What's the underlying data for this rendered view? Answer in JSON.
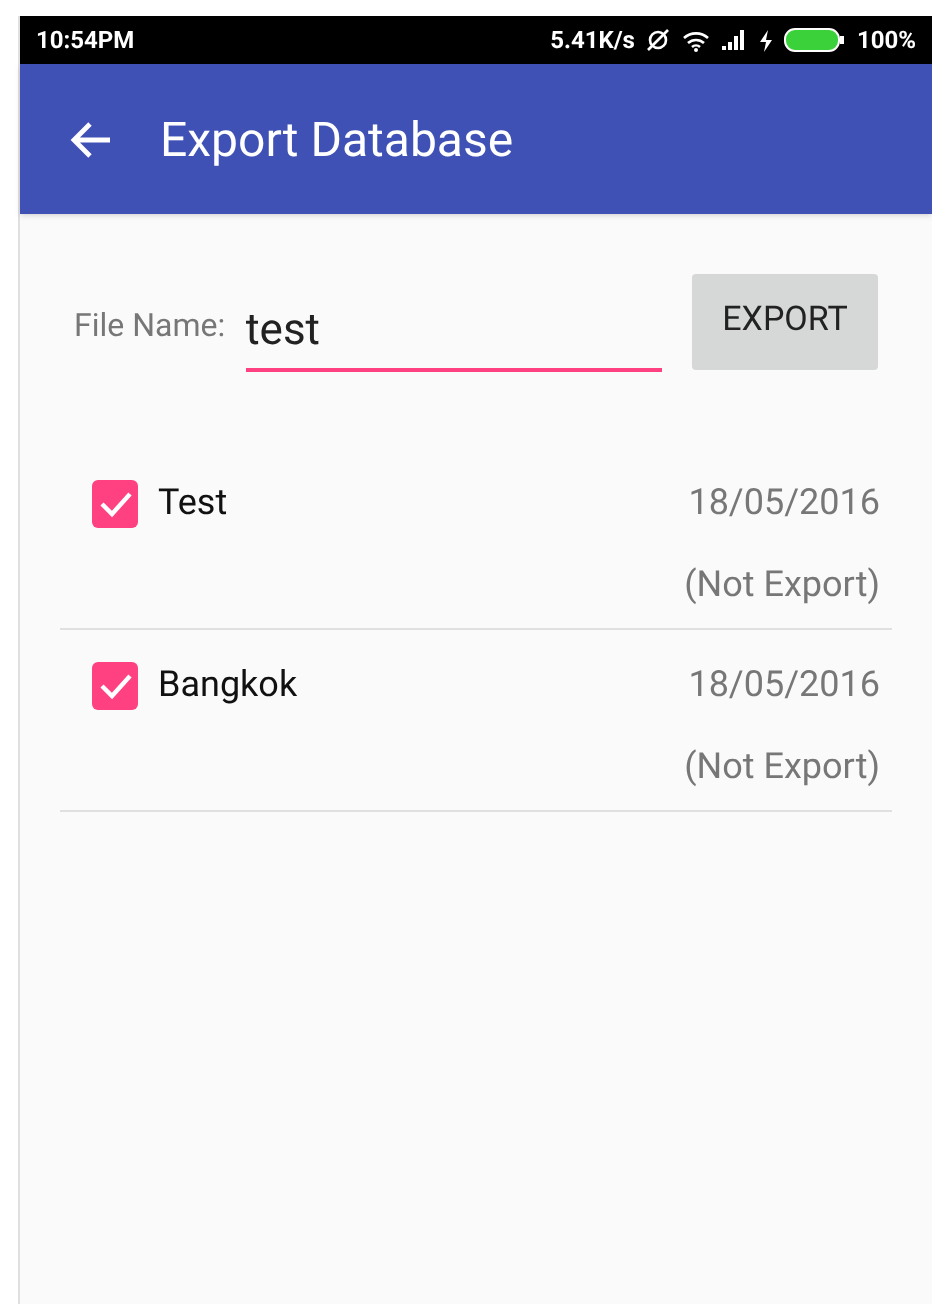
{
  "status_bar": {
    "time": "10:54PM",
    "speed": "5.41K/s",
    "battery": "100%"
  },
  "app_bar": {
    "title": "Export Database"
  },
  "file_name": {
    "label": "File Name:",
    "value": "test"
  },
  "export_button": "EXPORT",
  "items": [
    {
      "name": "Test",
      "checked": true,
      "date": "18/05/2016",
      "status": "(Not Export)"
    },
    {
      "name": "Bangkok",
      "checked": true,
      "date": "18/05/2016",
      "status": "(Not Export)"
    }
  ]
}
